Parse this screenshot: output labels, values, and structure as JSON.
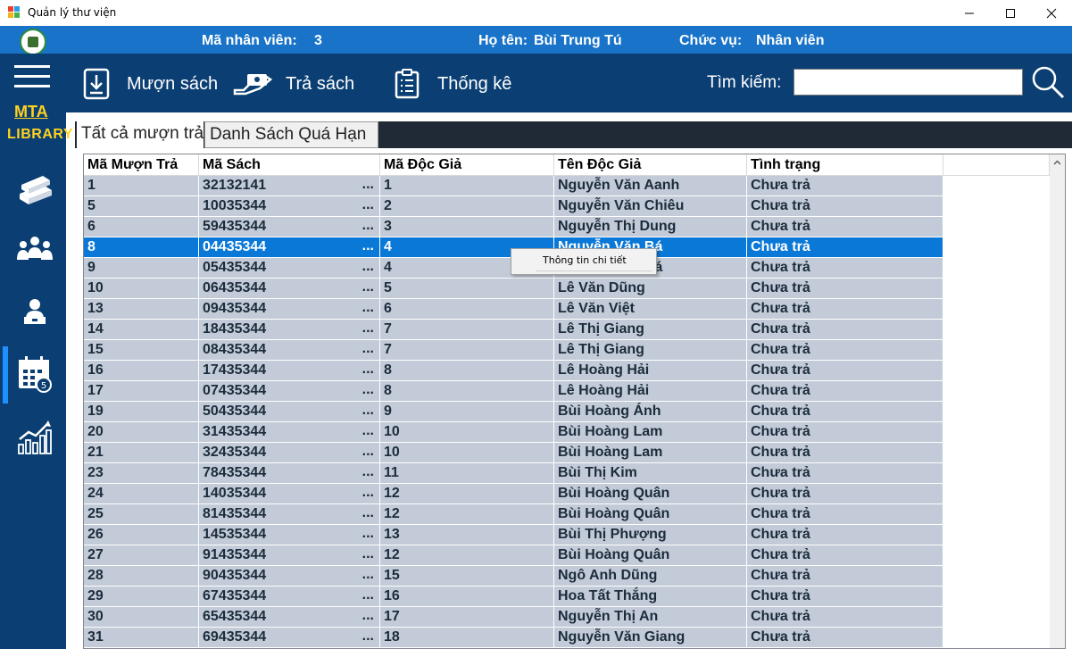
{
  "window": {
    "title": "Quản lý thư viện"
  },
  "info": {
    "staff_id_label": "Mã nhân viên:",
    "staff_id": "3",
    "name_label": "Họ tên:",
    "name": "Bùi Trung Tú",
    "role_label": "Chức vụ:",
    "role": "Nhân viên"
  },
  "sidebar": {
    "brand_top": "MTA",
    "brand_bottom": "LIBRARY",
    "items": [
      {
        "icon": "books-icon"
      },
      {
        "icon": "users-group-icon"
      },
      {
        "icon": "staff-laptop-icon"
      },
      {
        "icon": "calendar-icon",
        "active": true
      },
      {
        "icon": "stats-chart-icon"
      }
    ]
  },
  "toolbar": {
    "borrow_label": "Mượn sách",
    "return_label": "Trả sách",
    "stats_label": "Thống kê",
    "search_label": "Tìm kiếm:",
    "search_value": ""
  },
  "tabs": [
    {
      "label": "Tất cả mượn trả"
    },
    {
      "label": "Danh Sách Quá Hạn"
    }
  ],
  "grid": {
    "columns": [
      "Mã Mượn Trả",
      "Mã Sách",
      "Mã Độc Giả",
      "Tên Độc Giả",
      "Tình trạng"
    ],
    "selected_row": 3,
    "rows": [
      [
        "1",
        "32132141",
        "1",
        "Nguyễn Văn Aanh",
        "Chưa trả"
      ],
      [
        "5",
        "10035344",
        "2",
        "Nguyễn Văn Chiêu",
        "Chưa trả"
      ],
      [
        "6",
        "59435344",
        "3",
        "Nguyễn Thị Dung",
        "Chưa trả"
      ],
      [
        "8",
        "04435344",
        "4",
        "Nguyễn Văn Bá",
        "Chưa trả"
      ],
      [
        "9",
        "05435344",
        "4",
        "Nguyễn Văn Bá",
        "Chưa trả"
      ],
      [
        "10",
        "06435344",
        "5",
        "Lê Văn Dũng",
        "Chưa trả"
      ],
      [
        "13",
        "09435344",
        "6",
        "Lê Văn Việt",
        "Chưa trả"
      ],
      [
        "14",
        "18435344",
        "7",
        "Lê Thị Giang",
        "Chưa trả"
      ],
      [
        "15",
        "08435344",
        "7",
        "Lê Thị Giang",
        "Chưa trả"
      ],
      [
        "16",
        "17435344",
        "8",
        "Lê Hoàng Hải",
        "Chưa trả"
      ],
      [
        "17",
        "07435344",
        "8",
        "Lê Hoàng Hải",
        "Chưa trả"
      ],
      [
        "19",
        "50435344",
        "9",
        "Bùi Hoàng Ánh",
        "Chưa trả"
      ],
      [
        "20",
        "31435344",
        "10",
        "Bùi Hoàng Lam",
        "Chưa trả"
      ],
      [
        "21",
        "32435344",
        "10",
        "Bùi Hoàng Lam",
        "Chưa trả"
      ],
      [
        "23",
        "78435344",
        "11",
        "Bùi Thị Kim",
        "Chưa trả"
      ],
      [
        "24",
        "14035344",
        "12",
        "Bùi Hoàng Quân",
        "Chưa trả"
      ],
      [
        "25",
        "81435344",
        "12",
        "Bùi Hoàng Quân",
        "Chưa trả"
      ],
      [
        "26",
        "14535344",
        "13",
        "Bùi Thị Phượng",
        "Chưa trả"
      ],
      [
        "27",
        "91435344",
        "12",
        "Bùi Hoàng Quân",
        "Chưa trả"
      ],
      [
        "28",
        "90435344",
        "15",
        "Ngô Anh Dũng",
        "Chưa trả"
      ],
      [
        "29",
        "67435344",
        "16",
        "Hoa Tất Thắng",
        "Chưa trả"
      ],
      [
        "30",
        "65435344",
        "17",
        "Nguyễn Thị An",
        "Chưa trả"
      ],
      [
        "31",
        "69435344",
        "18",
        "Nguyễn Văn Giang",
        "Chưa trả"
      ]
    ],
    "ellipsis": "..."
  },
  "context_menu": {
    "item": "Thông tin chi tiết"
  },
  "colors": {
    "header_blue": "#1873c9",
    "sidebar_navy": "#0b3f73",
    "brand_yellow": "#ffd21f",
    "row_bg": "#c2cbd7",
    "selected_row": "#0a78d7"
  }
}
